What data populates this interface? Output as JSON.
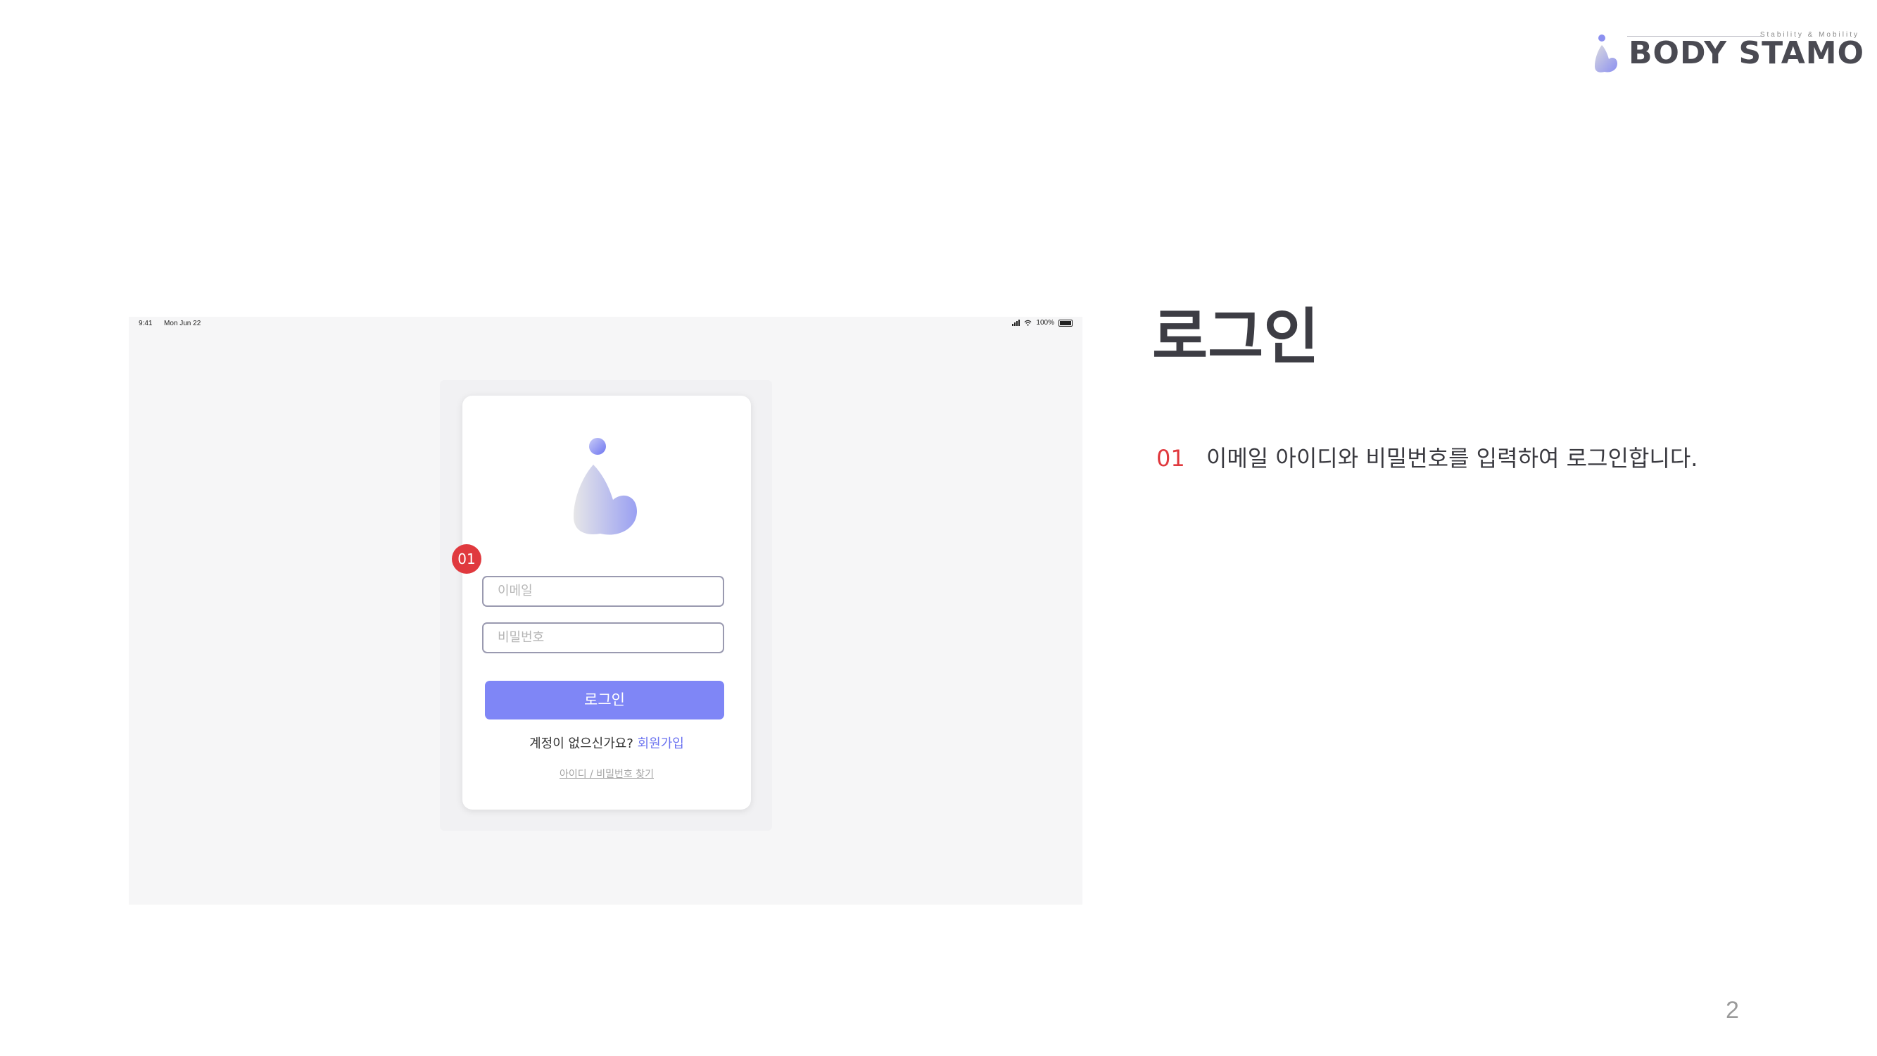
{
  "brand": {
    "name": "BODY STAMO",
    "tagline": "Stability & Mobility"
  },
  "colors": {
    "accent": "#7f86f6",
    "marker_red": "#e0393e",
    "title": "#3d3d44"
  },
  "screen": {
    "status_bar": {
      "time": "9:41",
      "date": "Mon Jun 22",
      "battery": "100%"
    },
    "login": {
      "email_placeholder": "이메일",
      "password_placeholder": "비밀번호",
      "login_button": "로그인",
      "signup_prompt": "계정이 없으신가요?",
      "signup_link": "회원가입",
      "find_link": "아이디 / 비밀번호 찾기"
    },
    "marker": "01"
  },
  "page": {
    "title": "로그인",
    "steps": [
      {
        "number": "01",
        "text": "이메일 아이디와 비밀번호를 입력하여 로그인합니다."
      }
    ],
    "page_number": "2"
  }
}
